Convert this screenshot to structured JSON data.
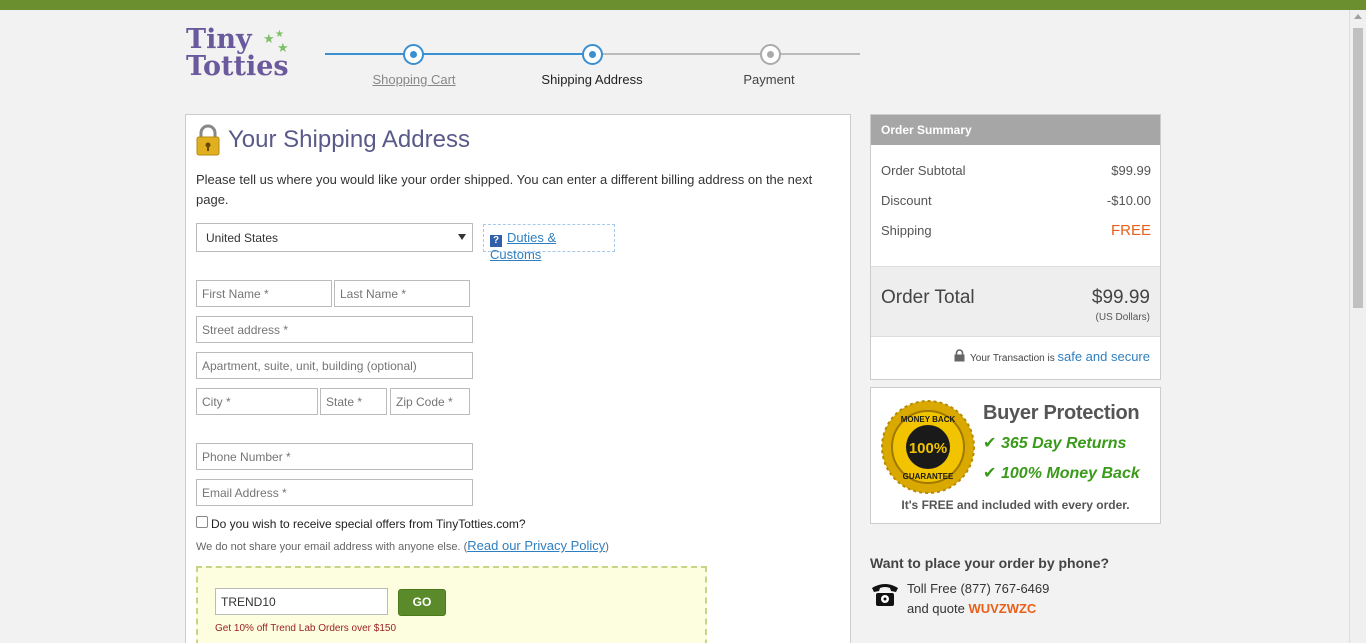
{
  "logo": {
    "line1": "Tiny",
    "line2": "Totties"
  },
  "steps": [
    {
      "label": "Shopping Cart",
      "state": "done"
    },
    {
      "label": "Shipping Address",
      "state": "current"
    },
    {
      "label": "Payment",
      "state": "pending"
    }
  ],
  "shipping": {
    "title": "Your Shipping Address",
    "intro": "Please tell us where you would like your order shipped. You can enter a different billing address on the next page.",
    "country": "United States",
    "duties_link": "Duties & Customs",
    "placeholders": {
      "first_name": "First Name *",
      "last_name": "Last Name *",
      "street": "Street address *",
      "apartment": "Apartment, suite, unit, building (optional)",
      "city": "City *",
      "state": "State *",
      "zip": "Zip Code *",
      "phone": "Phone Number *",
      "email": "Email Address *"
    },
    "offers_label": "Do you wish to receive special offers from TinyTotties.com?",
    "privacy_text": "We do not share your email address with anyone else. (",
    "privacy_link": "Read our Privacy Policy",
    "privacy_close": ")"
  },
  "promo": {
    "code_value": "TREND10",
    "go_label": "GO",
    "note": "Get 10% off Trend Lab Orders over $150"
  },
  "summary": {
    "heading": "Order Summary",
    "rows": [
      {
        "label": "Order Subtotal",
        "value": "$99.99"
      },
      {
        "label": "Discount",
        "value": "-$10.00"
      },
      {
        "label": "Shipping",
        "value": "FREE"
      }
    ],
    "total_label": "Order Total",
    "total_value": "$99.99",
    "total_currency": "(US Dollars)",
    "secure_prefix": "Your Transaction is ",
    "secure_link": "safe and secure"
  },
  "protection": {
    "title": "Buyer Protection",
    "line1": "365 Day Returns",
    "line2": "100% Money Back",
    "footer": "It's FREE and included with every order.",
    "seal_top": "MONEY BACK",
    "seal_center": "100%",
    "seal_bottom": "GUARANTEE"
  },
  "phone": {
    "heading": "Want to place your order by phone?",
    "line1": "Toll Free (877) 767-6469",
    "line2_prefix": "and quote ",
    "quote_code": "WUVZWZC"
  },
  "colors": {
    "brand_purple": "#6a5a9d",
    "step_blue": "#3a8fd0",
    "free_orange": "#e8601a",
    "go_green": "#5a8a2a",
    "topbar_green": "#6b8e2f"
  }
}
